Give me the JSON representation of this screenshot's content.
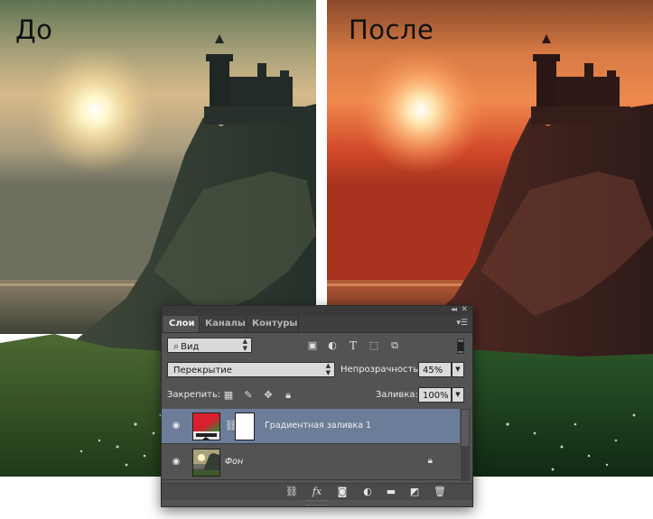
{
  "labels": {
    "before": "До",
    "after": "После"
  },
  "panel": {
    "tabs": [
      "Слои",
      "Каналы",
      "Контуры"
    ],
    "filter": {
      "value": "Вид"
    },
    "blend_mode": "Перекрытие",
    "opacity_label": "Непрозрачность:",
    "opacity_value": "45%",
    "lock_label": "Закрепить:",
    "fill_label": "Заливка:",
    "fill_value": "100%",
    "layers": [
      {
        "name": "Градиентная заливка 1",
        "selected": true,
        "visible": true,
        "thumb_icon": "gradient-fill-icon"
      },
      {
        "name": "Фон",
        "selected": false,
        "visible": true,
        "locked": true,
        "thumb_icon": "background-photo-thumbnail"
      }
    ],
    "bottom_icons": [
      "link-icon",
      "fx-icon",
      "mask-icon",
      "adjustment-icon",
      "folder-icon",
      "new-layer-icon",
      "trash-icon"
    ],
    "filter_icons": [
      "image-filter-icon",
      "adjustment-filter-icon",
      "type-filter-icon",
      "shape-filter-icon",
      "smart-object-filter-icon"
    ],
    "lock_icons": [
      "lock-transparent-icon",
      "lock-brush-icon",
      "lock-move-icon",
      "lock-all-icon"
    ]
  },
  "colors": {
    "panel_bg": "#535353",
    "selected_layer": "#6b7d98",
    "before_tint": "#c9a36b",
    "after_tint": "#d44a2c"
  }
}
